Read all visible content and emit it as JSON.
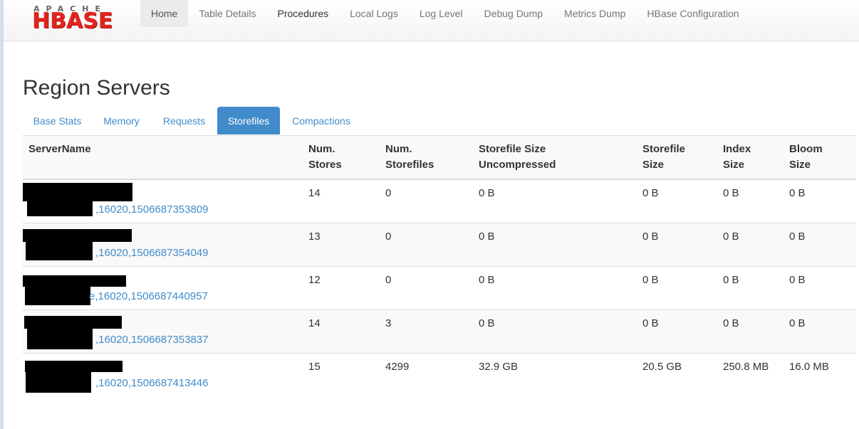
{
  "navbar": {
    "brand_top": "APACHE",
    "brand_main": "HBASE",
    "items": [
      {
        "label": "Home"
      },
      {
        "label": "Table Details"
      },
      {
        "label": "Procedures"
      },
      {
        "label": "Local Logs"
      },
      {
        "label": "Log Level"
      },
      {
        "label": "Debug Dump"
      },
      {
        "label": "Metrics Dump"
      },
      {
        "label": "HBase Configuration"
      }
    ]
  },
  "page_title": "Region Servers",
  "tabs": [
    {
      "label": "Base Stats"
    },
    {
      "label": "Memory"
    },
    {
      "label": "Requests"
    },
    {
      "label": "Storefiles",
      "active": true
    },
    {
      "label": "Compactions"
    }
  ],
  "table": {
    "headers": {
      "server_name": "ServerName",
      "num_stores_1": "Num.",
      "num_stores_2": "Stores",
      "num_storefiles_1": "Num.",
      "num_storefiles_2": "Storefiles",
      "sf_uncompressed_1": "Storefile Size",
      "sf_uncompressed_2": "Uncompressed",
      "sf_size_1": "Storefile",
      "sf_size_2": "Size",
      "index_1": "Index",
      "index_2": "Size",
      "bloom_1": "Bloom",
      "bloom_2": "Size"
    },
    "rows": [
      {
        "server": ",16020,1506687353809",
        "stores": "14",
        "storefiles": "0",
        "uncompressed": "0 B",
        "size": "0 B",
        "index": "0 B",
        "bloom": "0 B"
      },
      {
        "server": ",16020,1506687354049",
        "stores": "13",
        "storefiles": "0",
        "uncompressed": "0 B",
        "size": "0 B",
        "index": "0 B",
        "bloom": "0 B"
      },
      {
        "server": "e,16020,1506687440957",
        "stores": "12",
        "storefiles": "0",
        "uncompressed": "0 B",
        "size": "0 B",
        "index": "0 B",
        "bloom": "0 B"
      },
      {
        "server": ",16020,1506687353837",
        "stores": "14",
        "storefiles": "3",
        "uncompressed": "0 B",
        "size": "0 B",
        "index": "0 B",
        "bloom": "0 B"
      },
      {
        "server": ",16020,1506687413446",
        "stores": "15",
        "storefiles": "4299",
        "uncompressed": "32.9 GB",
        "size": "20.5 GB",
        "index": "250.8 MB",
        "bloom": "16.0 MB"
      }
    ]
  },
  "colors": {
    "link": "#428bca",
    "brand_red": "#e1251b",
    "tab_active_bg": "#428bca"
  }
}
